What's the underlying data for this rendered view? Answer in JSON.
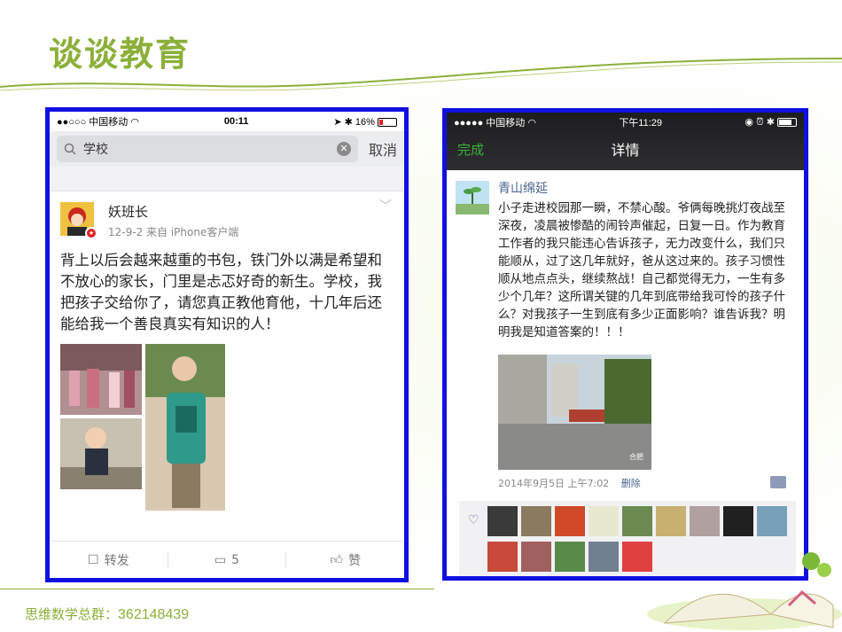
{
  "slide": {
    "title": "谈谈教育",
    "footer_label": "思维数学总群：",
    "footer_number": "362148439",
    "accent_color": "#8bb03a"
  },
  "left_phone": {
    "status": {
      "carrier": "●●○○○ 中国移动 ",
      "time": "00:11",
      "battery": "16%"
    },
    "search": {
      "query": "学校",
      "cancel_label": "取消"
    },
    "post": {
      "username": "妖班长",
      "meta": "12-9-2  来自 iPhone客户端",
      "text": "背上以后会越来越重的书包，铁门外以满是希望和不放心的家长，门里是忐忑好奇的新生。学校，我把孩子交给你了，请您真正教他育他，十几年后还能给我一个善良真实有知识的人！"
    },
    "actions": {
      "repost": "转发",
      "comment_count": "5",
      "like": "赞"
    }
  },
  "right_phone": {
    "status": {
      "carrier": "●●●●● 中国移动 ",
      "time": "下午11:29"
    },
    "nav": {
      "done_label": "完成",
      "title": "详情"
    },
    "moment": {
      "username": "青山绵延",
      "text": "小子走进校园那一瞬，不禁心酸。爷俩每晚挑灯夜战至深夜，凌晨被惨酷的闹铃声催起，日复一日。作为教育工作者的我只能违心告诉孩子，无力改变什么，我们只能顺从，过了这几年就好，爸从这过来的。孩子习惯性顺从地点点头，继续熬战！自己都觉得无力，一生有多少个几年？这所谓关键的几年到底带给我可怜的孩子什么？对我孩子一生到底有多少正面影响？谁告诉我？明明我是知道答案的！！！",
      "photo_caption": "合肥",
      "date": "2014年9月5日 上午7:02",
      "delete_label": "删除"
    },
    "likes": {
      "count_shown": 14,
      "colors": [
        "#3a3a3a",
        "#8a7a60",
        "#d04a2a",
        "#e8e8d0",
        "#6a8a50",
        "#c8b070",
        "#b0a0a0",
        "#202020",
        "#78a0b8",
        "#c84a3a",
        "#a06060",
        "#5a8a4a",
        "#708090",
        "#e04040"
      ]
    }
  }
}
